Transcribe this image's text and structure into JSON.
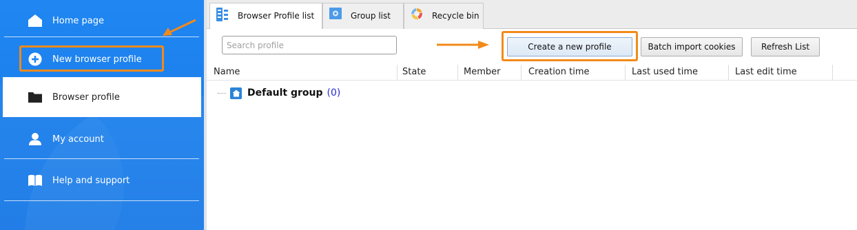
{
  "sidebar": {
    "items": [
      {
        "label": "Home page",
        "icon": "home-icon"
      },
      {
        "label": "New browser profile",
        "icon": "plus-circle-icon"
      },
      {
        "label": "Browser profile",
        "icon": "folder-icon"
      },
      {
        "label": "My account",
        "icon": "user-icon"
      },
      {
        "label": "Help and support",
        "icon": "book-icon"
      }
    ],
    "active_item": "Browser profile"
  },
  "tabs": [
    {
      "label": "Browser Profile list",
      "icon": "profile-list-icon",
      "active": true
    },
    {
      "label": "Group list",
      "icon": "group-list-icon",
      "active": false
    },
    {
      "label": "Recycle bin",
      "icon": "recycle-bin-icon",
      "active": false
    }
  ],
  "toolbar": {
    "search_placeholder": "Search profile",
    "create_label": "Create a new profile",
    "batch_label": "Batch import cookies",
    "refresh_label": "Refresh List"
  },
  "table": {
    "columns": [
      "Name",
      "State",
      "Member",
      "Creation time",
      "Last used time",
      "Last edit time"
    ]
  },
  "groups": [
    {
      "name": "Default group",
      "count": "(0)"
    }
  ],
  "colors": {
    "sidebar_blue": "#1f86f2",
    "highlight_orange": "#f28a1a",
    "count_blue": "#2a2ad0"
  }
}
